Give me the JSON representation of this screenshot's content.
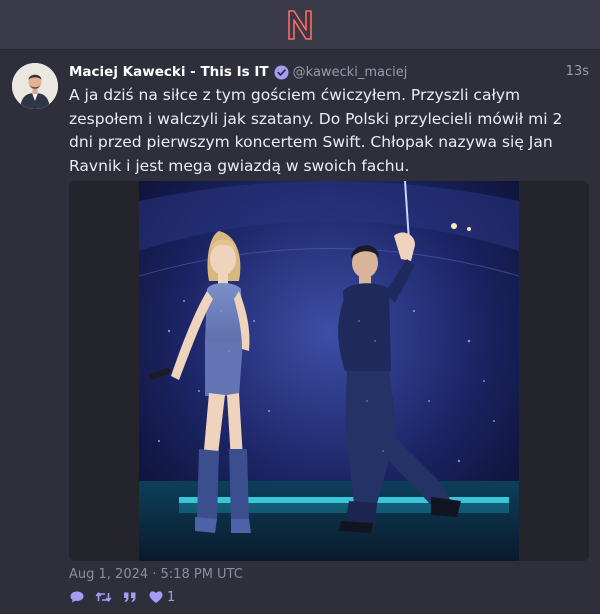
{
  "app": {
    "logo_letter": "N"
  },
  "post": {
    "author": {
      "display_name": "Maciej Kawecki - This Is IT",
      "handle": "@kawecki_maciej",
      "verified": true
    },
    "time_ago": "13s",
    "text": "A ja dziś na siłce z tym gościem ćwiczyłem. Przyszli całym zespołem i walczyli jak szatany. Do Polski przylecieli mówił mi 2 dni przed pierwszym koncertem Swift. Chłopak nazywa się Jan Ravnik i jest mega gwiazdą w swoich fachu.",
    "date": "Aug 1, 2024 · 5:18 PM UTC",
    "actions": {
      "reply_icon": "speech-bubble-icon",
      "boost_icon": "retweet-icon",
      "quote_icon": "quote-icon",
      "favorite_icon": "heart-icon",
      "favorite_count": "1"
    }
  },
  "colors": {
    "background": "#2f2f3b",
    "topbar": "#393947",
    "accent": "#a79cf5",
    "logo": "#ff6c60",
    "verified": "#a79cf5"
  }
}
